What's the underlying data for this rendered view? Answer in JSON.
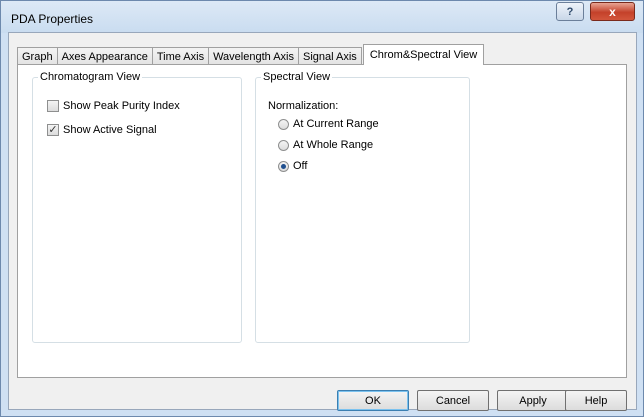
{
  "window": {
    "title": "PDA Properties"
  },
  "titlebar": {
    "help_glyph": "?",
    "close_glyph": "x"
  },
  "tabs": [
    {
      "label": "Graph"
    },
    {
      "label": "Axes Appearance"
    },
    {
      "label": "Time Axis"
    },
    {
      "label": "Wavelength Axis"
    },
    {
      "label": "Signal Axis"
    },
    {
      "label": "Chrom&Spectral View",
      "active": true
    }
  ],
  "chromatogram_view": {
    "title": "Chromatogram View",
    "options": [
      {
        "label": "Show Peak Purity Index",
        "checked": false
      },
      {
        "label": "Show Active Signal",
        "checked": true
      }
    ]
  },
  "spectral_view": {
    "title": "Spectral View",
    "normalization_label": "Normalization:",
    "options": [
      {
        "label": "At Current Range",
        "selected": false
      },
      {
        "label": "At Whole Range",
        "selected": false
      },
      {
        "label": "Off",
        "selected": true
      }
    ]
  },
  "buttons": {
    "ok": "OK",
    "cancel": "Cancel",
    "apply": "Apply",
    "help": "Help"
  },
  "colors": {
    "title_bar": "#c9dcf0",
    "close_button": "#c4412a",
    "selected_radio": "#1f4f8f"
  },
  "icons": {
    "help": "question-mark-icon",
    "close": "close-icon",
    "check": "checkmark-icon"
  }
}
